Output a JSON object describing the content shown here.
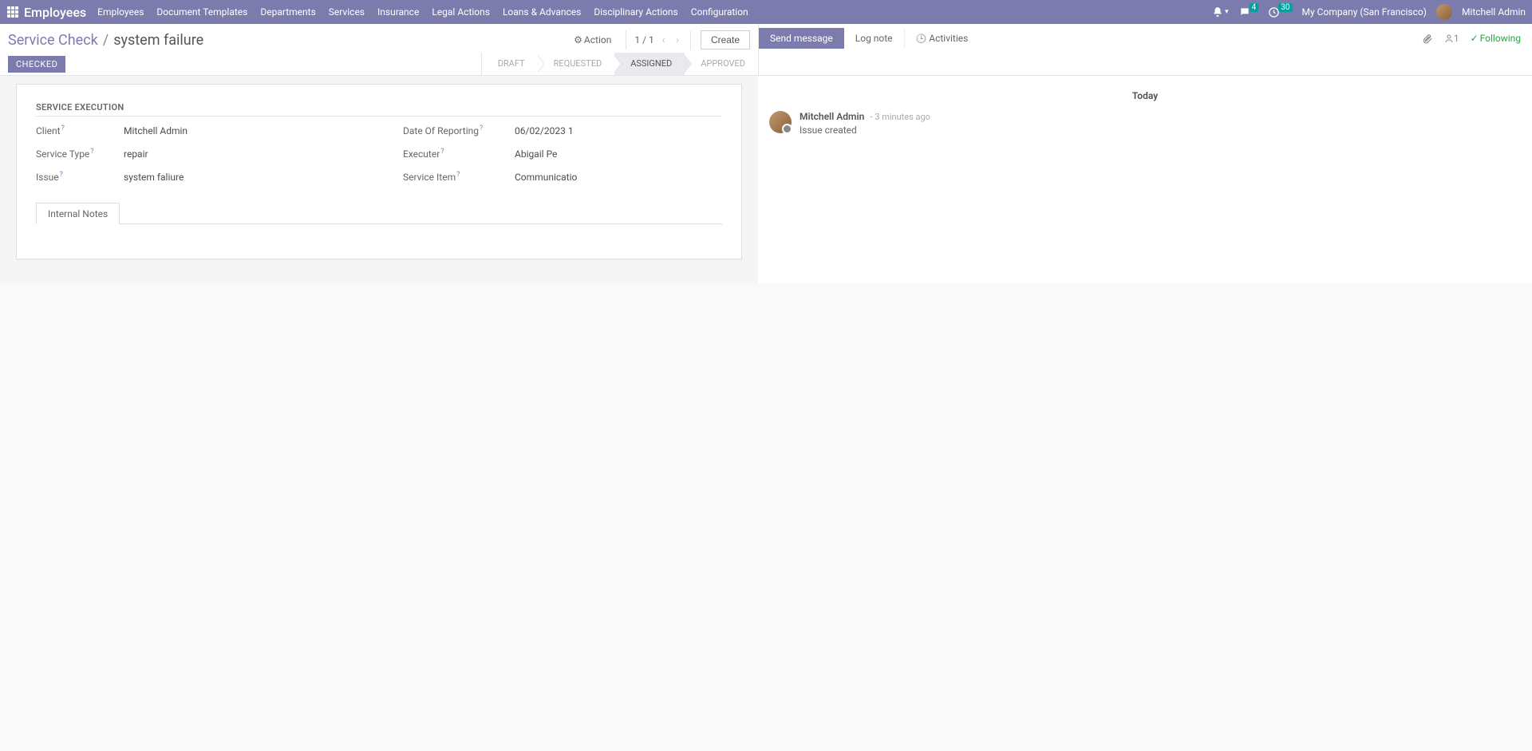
{
  "topnav": {
    "brand": "Employees",
    "menu": [
      "Employees",
      "Document Templates",
      "Departments",
      "Services",
      "Insurance",
      "Legal Actions",
      "Loans & Advances",
      "Disciplinary Actions",
      "Configuration"
    ],
    "chat_badge": "4",
    "clock_badge": "30",
    "company": "My Company (San Francisco)",
    "user": "Mitchell Admin"
  },
  "breadcrumb": {
    "parent": "Service Check",
    "current": "system failure",
    "action_label": "Action",
    "pager": "1 / 1",
    "create_label": "Create"
  },
  "status": {
    "checked_badge": "CHECKED",
    "stages": [
      "DRAFT",
      "REQUESTED",
      "ASSIGNED",
      "APPROVED"
    ],
    "active_stage_index": 2
  },
  "chatter_tabs": {
    "send": "Send message",
    "log": "Log note",
    "activities": "Activities",
    "follower_count": "1",
    "following": "Following"
  },
  "form": {
    "section_title": "SERVICE EXECUTION",
    "left": [
      {
        "label": "Client",
        "value": "Mitchell Admin"
      },
      {
        "label": "Service Type",
        "value": "repair"
      },
      {
        "label": "Issue",
        "value": "system faliure"
      }
    ],
    "right": [
      {
        "label": "Date Of Reporting",
        "value": "06/02/2023 1"
      },
      {
        "label": "Executer",
        "value": "Abigail Pe"
      },
      {
        "label": "Service Item",
        "value": "Communicatio"
      }
    ],
    "tab_label": "Internal Notes"
  },
  "chatter": {
    "today": "Today",
    "messages": [
      {
        "author": "Mitchell Admin",
        "time": "- 3 minutes ago",
        "text": "Issue created"
      }
    ]
  }
}
